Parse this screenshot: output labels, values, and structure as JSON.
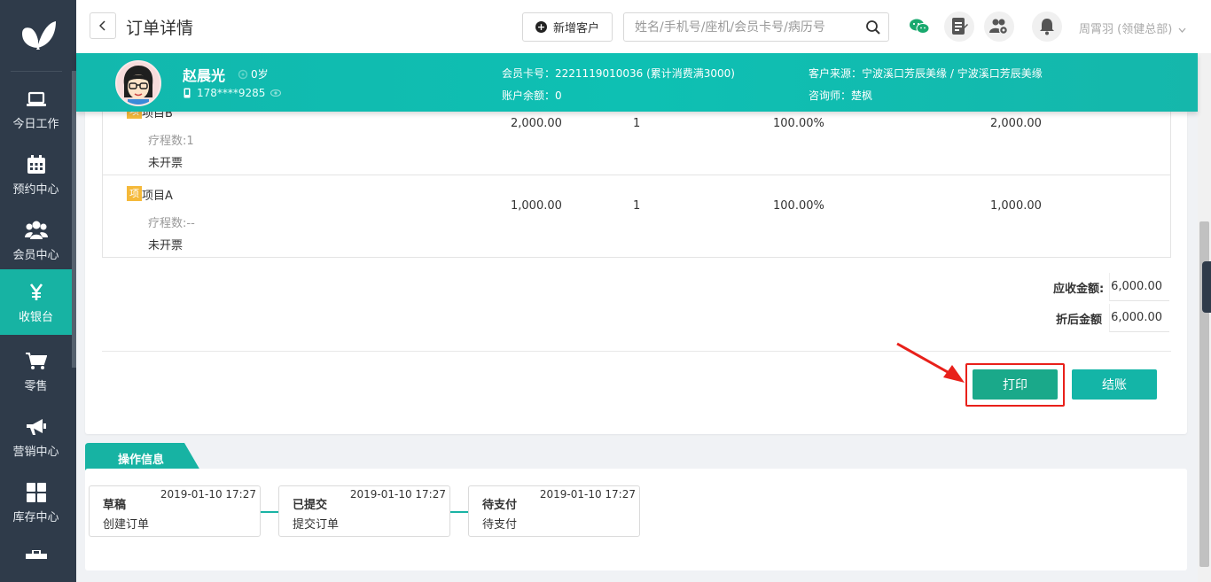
{
  "sidebar": {
    "items": [
      {
        "label": "今日工作",
        "icon": "laptop-icon"
      },
      {
        "label": "预约中心",
        "icon": "calendar-icon"
      },
      {
        "label": "会员中心",
        "icon": "members-icon"
      },
      {
        "label": "收银台",
        "icon": "yen-icon",
        "active": true
      },
      {
        "label": "零售",
        "icon": "cart-icon"
      },
      {
        "label": "营销中心",
        "icon": "megaphone-icon"
      },
      {
        "label": "库存中心",
        "icon": "grid-icon"
      }
    ]
  },
  "header": {
    "title": "订单详情",
    "add_customer": "新增客户",
    "search_placeholder": "姓名/手机号/座机/会员卡号/病历号",
    "user": "周霄羽 (领健总部)"
  },
  "customer": {
    "name": "赵晨光",
    "age": "0岁",
    "phone": "178****9285",
    "card_label": "会员卡号：",
    "card_value": "2221119010036 (累计消费满3000)",
    "balance_label": "账户余额：",
    "balance_value": "0",
    "source_label": "客户来源：",
    "source_value": "宁波溪口芳辰美缘 / 宁波溪口芳辰美缘",
    "consultant_label": "咨询师：",
    "consultant_value": "楚枫"
  },
  "items": [
    {
      "badge": "项",
      "name": "项目B",
      "sessions": "疗程数:1",
      "invoice": "未开票",
      "price": "2,000.00",
      "qty": "1",
      "discount": "100.00%",
      "amount": "2,000.00"
    },
    {
      "badge": "项",
      "name": "项目A",
      "sessions": "疗程数:--",
      "invoice": "未开票",
      "price": "1,000.00",
      "qty": "1",
      "discount": "100.00%",
      "amount": "1,000.00"
    }
  ],
  "summary": {
    "receivable_label": "应收金额:",
    "receivable_value": "6,000.00",
    "discounted_label": "折后金额",
    "discounted_value": "6,000.00"
  },
  "actions": {
    "print": "打印",
    "checkout": "结账"
  },
  "operations": {
    "tab": "操作信息",
    "steps": [
      {
        "title": "草稿",
        "time": "2019-01-10 17:27",
        "desc": "创建订单"
      },
      {
        "title": "已提交",
        "time": "2019-01-10 17:27",
        "desc": "提交订单"
      },
      {
        "title": "待支付",
        "time": "2019-01-10 17:27",
        "desc": "待支付"
      }
    ]
  },
  "colors": {
    "sidebar": "#2f3b4a",
    "accent": "#17b3a3",
    "print_button": "#1aa98a",
    "highlight": "#e8201a",
    "badge": "#f5b93a"
  }
}
